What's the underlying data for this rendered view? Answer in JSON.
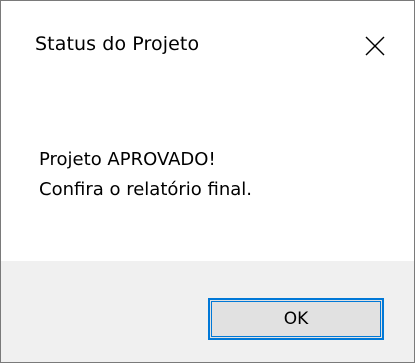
{
  "dialog": {
    "title": "Status do Projeto",
    "close_icon": "close-icon",
    "message_line1": "Projeto APROVADO!",
    "message_line2": "Confira o relatório final.",
    "ok_label": "OK"
  },
  "colors": {
    "focus_border": "#0078d7",
    "footer_bg": "#f0f0f0",
    "button_bg": "#e1e1e1"
  }
}
